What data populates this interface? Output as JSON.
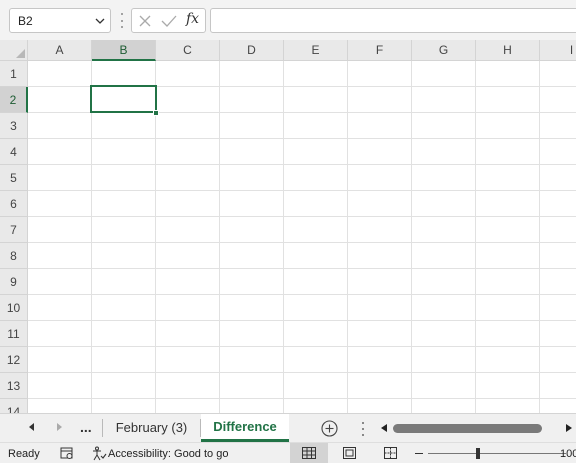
{
  "formula_bar": {
    "name_box": "B2",
    "formula_value": "",
    "function_icon": "fx"
  },
  "columns": [
    "A",
    "B",
    "C",
    "D",
    "E",
    "F",
    "G",
    "H",
    "I"
  ],
  "rows": [
    "1",
    "2",
    "3",
    "4",
    "5",
    "6",
    "7",
    "8",
    "9",
    "10",
    "11",
    "12",
    "13",
    "14"
  ],
  "selection": {
    "column": "B",
    "row": "2"
  },
  "sheet_tabs": {
    "more_label": "...",
    "tabs": [
      {
        "label": "February (3)",
        "active": false
      },
      {
        "label": "Difference",
        "active": true
      }
    ]
  },
  "status_bar": {
    "ready": "Ready",
    "accessibility": "Accessibility: Good to go",
    "zoom_level": "100%"
  },
  "colors": {
    "accent": "#217346",
    "header_bg": "#e9e9e9",
    "selected_header_bg": "#d2d2d2"
  },
  "icons": [
    "chevron-down-icon",
    "cancel-icon",
    "enter-icon",
    "function-icon",
    "scroll-left-icon",
    "scroll-right-icon",
    "add-sheet-icon",
    "macro-record-icon",
    "accessibility-icon",
    "normal-view-icon",
    "page-layout-icon",
    "page-break-icon"
  ]
}
